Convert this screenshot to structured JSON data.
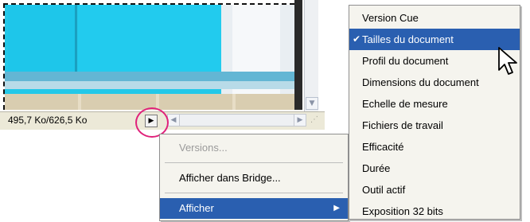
{
  "status": {
    "text": "495,7 Ko/626,5 Ko",
    "menu_arrow_icon": "triangle-right-icon"
  },
  "context_menu": {
    "items": [
      {
        "label": "Versions...",
        "disabled": true
      },
      {
        "label": "Afficher dans Bridge..."
      },
      {
        "label": "Afficher",
        "selected": true,
        "has_submenu": true
      }
    ]
  },
  "submenu": {
    "items": [
      {
        "label": "Version Cue"
      },
      {
        "label": "Tailles du document",
        "checked": true,
        "selected": true
      },
      {
        "label": "Profil du document"
      },
      {
        "label": "Dimensions du document"
      },
      {
        "label": "Echelle de mesure"
      },
      {
        "label": "Fichiers de travail"
      },
      {
        "label": "Efficacité"
      },
      {
        "label": "Durée"
      },
      {
        "label": "Outil actif"
      },
      {
        "label": "Exposition 32 bits"
      }
    ]
  },
  "colors": {
    "selection": "#2a5fb0",
    "highlight_circle": "#e0217a",
    "canvas_cyan": "#23c8e8"
  }
}
